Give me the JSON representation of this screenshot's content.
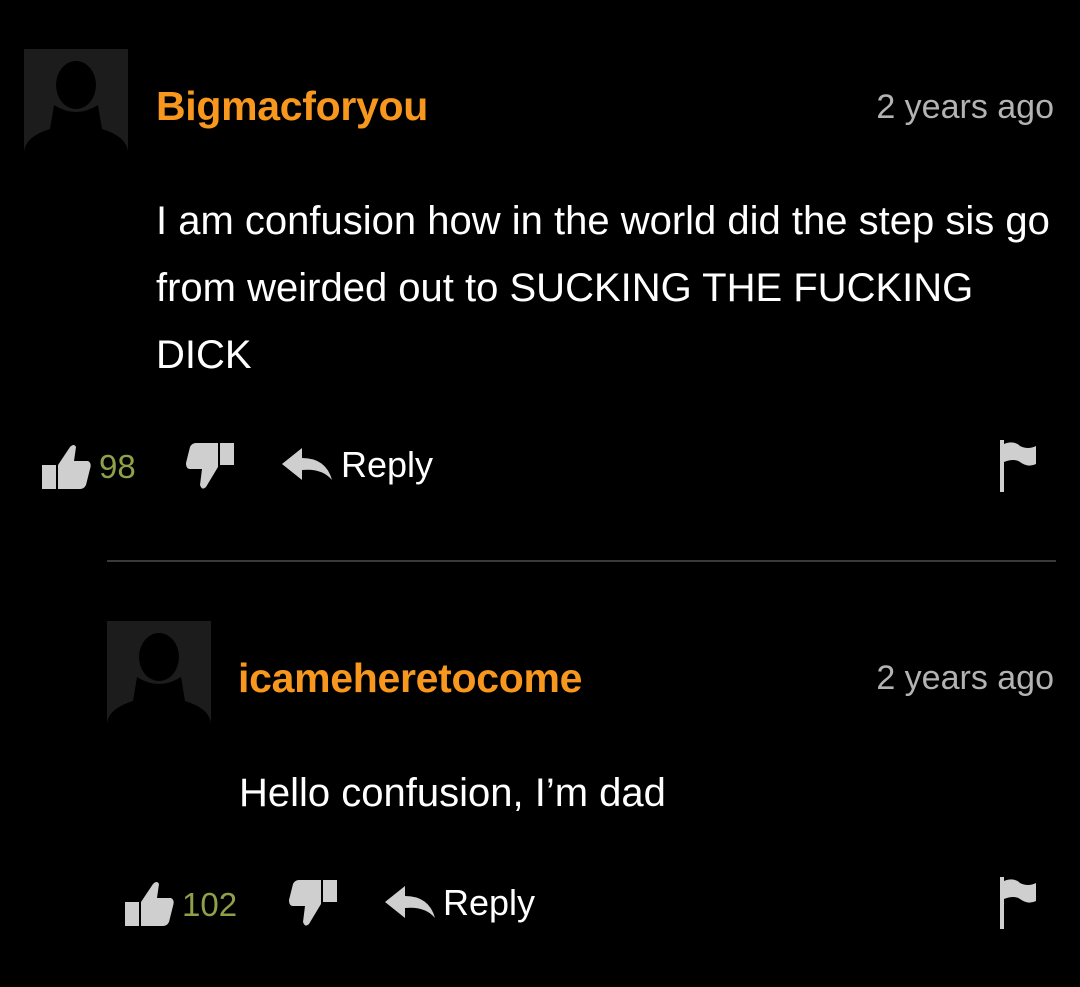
{
  "theme": {
    "background": "#000000",
    "username_color": "#f7971d",
    "count_color": "#8fa04a",
    "icon_color": "#cfcfcf",
    "timestamp_color": "#b3b3b3"
  },
  "comments": [
    {
      "username": "Bigmacforyou",
      "timestamp": "2 years ago",
      "text": "I am confusion how in the world did the step sis go from weirded out to SUCKING THE FUCKING DICK",
      "like_count": "98",
      "reply_label": "Reply",
      "icons": [
        "avatar-placeholder",
        "thumbs-up-icon",
        "thumbs-down-icon",
        "reply-arrow-icon",
        "flag-icon"
      ]
    },
    {
      "username": "icameheretocome",
      "timestamp": "2 years ago",
      "text": "Hello confusion, I’m dad",
      "like_count": "102",
      "reply_label": "Reply",
      "icons": [
        "avatar-placeholder",
        "thumbs-up-icon",
        "thumbs-down-icon",
        "reply-arrow-icon",
        "flag-icon"
      ]
    }
  ]
}
